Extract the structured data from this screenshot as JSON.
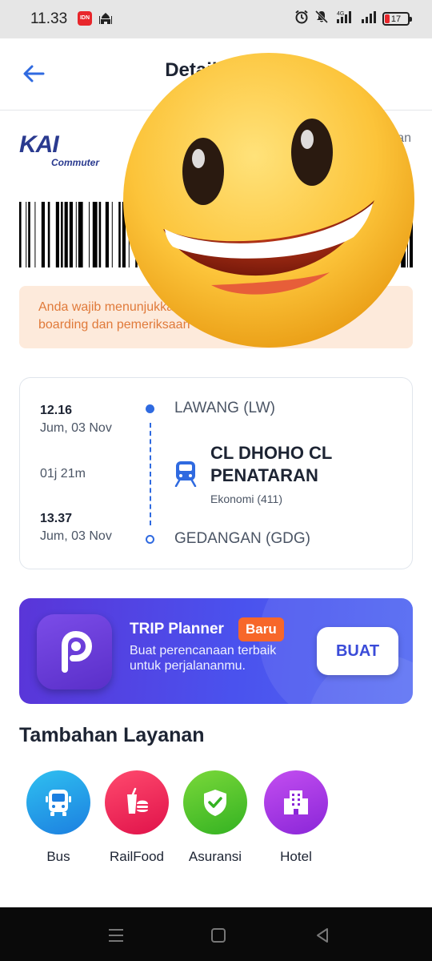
{
  "status_bar": {
    "time": "11.33",
    "idn_label": "IDN",
    "battery": "17",
    "network": "4G"
  },
  "header": {
    "title": "Detail Tiket"
  },
  "ticket": {
    "operator_main": "KAI",
    "operator_sub": "Commuter",
    "right_note": "an",
    "notice_line1": "Anda wajib menunjukkan",
    "notice_line2": "boarding dan pemeriksaan"
  },
  "journey": {
    "departure_time": "12.16",
    "departure_date": "Jum, 03 Nov",
    "duration": "01j 21m",
    "arrival_time": "13.37",
    "arrival_date": "Jum, 03 Nov",
    "origin": "LAWANG (LW)",
    "destination": "GEDANGAN (GDG)",
    "train_name": "CL DHOHO CL PENATARAN",
    "train_class": "Ekonomi (411)"
  },
  "trip_planner": {
    "title": "TRIP Planner",
    "badge": "Baru",
    "description": "Buat perencanaan terbaik untuk perjalananmu.",
    "button": "BUAT"
  },
  "services": {
    "title": "Tambahan Layanan",
    "items": [
      {
        "label": "Bus",
        "icon": "bus-icon",
        "color_from": "#2fc0f0",
        "color_to": "#1c7fe0"
      },
      {
        "label": "RailFood",
        "icon": "food-icon",
        "color_from": "#ff4a6e",
        "color_to": "#e0124a"
      },
      {
        "label": "Asuransi",
        "icon": "shield-icon",
        "color_from": "#7ad83a",
        "color_to": "#34b222"
      },
      {
        "label": "Hotel",
        "icon": "hotel-icon",
        "color_from": "#c34ef0",
        "color_to": "#8a26d8"
      }
    ]
  },
  "colors": {
    "primary": "#2f6ae0",
    "accent": "#f7672a",
    "notice_bg": "#fdeadb",
    "notice_text": "#e07a3a"
  }
}
